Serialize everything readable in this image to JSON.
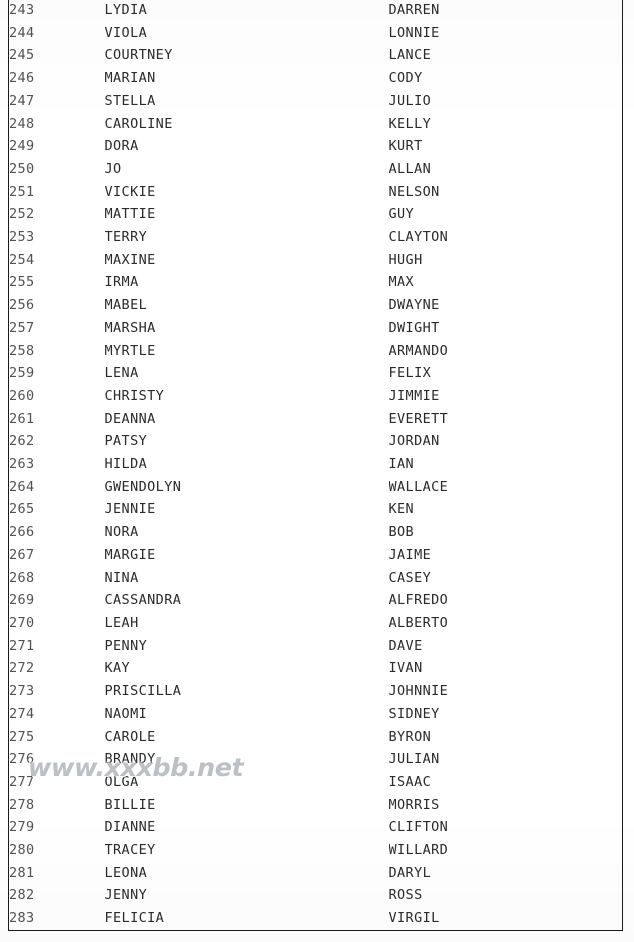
{
  "document": {
    "kind": "scanned-table",
    "page_background": "#ffffff",
    "border_color": "#1a1a1a",
    "index_text_color": "#525252",
    "name_text_color": "#2b2b2b"
  },
  "table": {
    "column_count": 3,
    "row_count": 41,
    "first_index": "243",
    "last_index": "283",
    "columns": [
      {
        "key": "index",
        "name": "index-column"
      },
      {
        "key": "female",
        "name": "female-name-column"
      },
      {
        "key": "male",
        "name": "male-name-column"
      }
    ],
    "rows": [
      {
        "index": "243",
        "female": "LYDIA",
        "male": "DARREN"
      },
      {
        "index": "244",
        "female": "VIOLA",
        "male": "LONNIE"
      },
      {
        "index": "245",
        "female": "COURTNEY",
        "male": "LANCE"
      },
      {
        "index": "246",
        "female": "MARIAN",
        "male": "CODY"
      },
      {
        "index": "247",
        "female": "STELLA",
        "male": "JULIO"
      },
      {
        "index": "248",
        "female": "CAROLINE",
        "male": "KELLY"
      },
      {
        "index": "249",
        "female": "DORA",
        "male": "KURT"
      },
      {
        "index": "250",
        "female": "JO",
        "male": "ALLAN"
      },
      {
        "index": "251",
        "female": "VICKIE",
        "male": "NELSON"
      },
      {
        "index": "252",
        "female": "MATTIE",
        "male": "GUY"
      },
      {
        "index": "253",
        "female": "TERRY",
        "male": "CLAYTON"
      },
      {
        "index": "254",
        "female": "MAXINE",
        "male": "HUGH"
      },
      {
        "index": "255",
        "female": "IRMA",
        "male": "MAX"
      },
      {
        "index": "256",
        "female": "MABEL",
        "male": "DWAYNE"
      },
      {
        "index": "257",
        "female": "MARSHA",
        "male": "DWIGHT"
      },
      {
        "index": "258",
        "female": "MYRTLE",
        "male": "ARMANDO"
      },
      {
        "index": "259",
        "female": "LENA",
        "male": "FELIX"
      },
      {
        "index": "260",
        "female": "CHRISTY",
        "male": "JIMMIE"
      },
      {
        "index": "261",
        "female": "DEANNA",
        "male": "EVERETT"
      },
      {
        "index": "262",
        "female": "PATSY",
        "male": "JORDAN"
      },
      {
        "index": "263",
        "female": "HILDA",
        "male": "IAN"
      },
      {
        "index": "264",
        "female": "GWENDOLYN",
        "male": "WALLACE"
      },
      {
        "index": "265",
        "female": "JENNIE",
        "male": "KEN"
      },
      {
        "index": "266",
        "female": "NORA",
        "male": "BOB"
      },
      {
        "index": "267",
        "female": "MARGIE",
        "male": "JAIME"
      },
      {
        "index": "268",
        "female": "NINA",
        "male": "CASEY"
      },
      {
        "index": "269",
        "female": "CASSANDRA",
        "male": "ALFREDO"
      },
      {
        "index": "270",
        "female": "LEAH",
        "male": "ALBERTO"
      },
      {
        "index": "271",
        "female": "PENNY",
        "male": "DAVE"
      },
      {
        "index": "272",
        "female": "KAY",
        "male": "IVAN"
      },
      {
        "index": "273",
        "female": "PRISCILLA",
        "male": "JOHNNIE"
      },
      {
        "index": "274",
        "female": "NAOMI",
        "male": "SIDNEY"
      },
      {
        "index": "275",
        "female": "CAROLE",
        "male": "BYRON"
      },
      {
        "index": "276",
        "female": "BRANDY",
        "male": "JULIAN"
      },
      {
        "index": "277",
        "female": "OLGA",
        "male": "ISAAC"
      },
      {
        "index": "278",
        "female": "BILLIE",
        "male": "MORRIS"
      },
      {
        "index": "279",
        "female": "DIANNE",
        "male": "CLIFTON"
      },
      {
        "index": "280",
        "female": "TRACEY",
        "male": "WILLARD"
      },
      {
        "index": "281",
        "female": "LEONA",
        "male": "DARYL"
      },
      {
        "index": "282",
        "female": "JENNY",
        "male": "ROSS"
      },
      {
        "index": "283",
        "female": "FELICIA",
        "male": "VIRGIL"
      }
    ]
  },
  "watermark": {
    "text": "www.xxxbb.net",
    "color": "#767c84",
    "row_overlapped": "276"
  }
}
